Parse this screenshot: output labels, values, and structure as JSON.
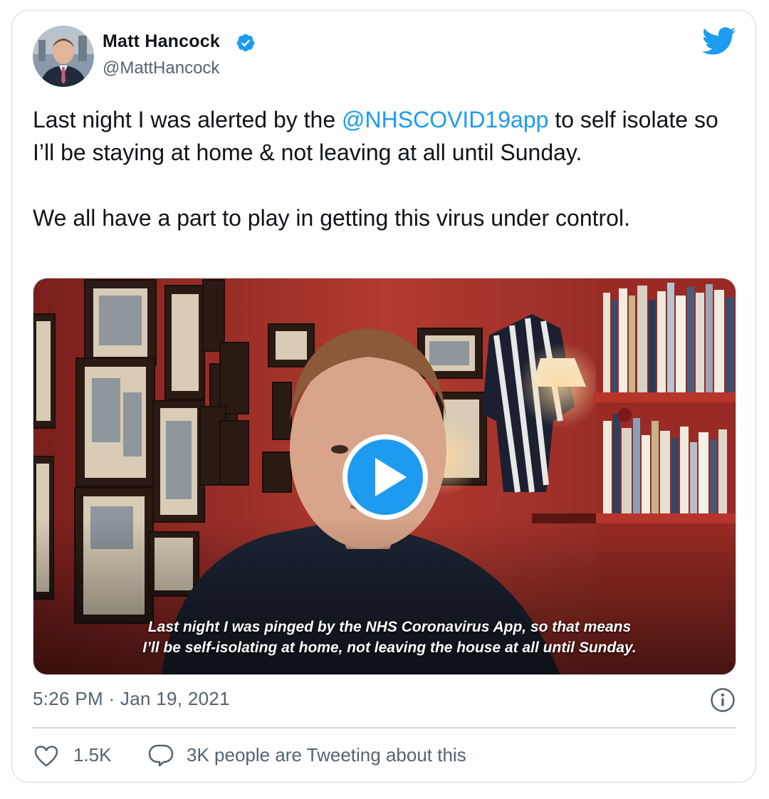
{
  "author": {
    "name": "Matt Hancock",
    "handle": "@MattHancock",
    "verified": true,
    "verified_icon": "verified-badge-icon",
    "avatar_icon": "avatar"
  },
  "brand": {
    "logo_icon": "twitter-bird-icon",
    "color": "#1d9bf0"
  },
  "tweet": {
    "line1_before": "Last night I was alerted by the ",
    "mention": "@NHSCOVID19app",
    "line1_after": " to self isolate so I’ll be staying at home & not leaving at all until Sunday.",
    "paragraph2": "We all have a part to play in getting this virus under control."
  },
  "video": {
    "caption_line1": "Last night I was pinged by the NHS Coronavirus App, so that means",
    "caption_line2": "I’ll be self-isolating at home, not leaving the house at all until Sunday.",
    "play_icon": "play-icon"
  },
  "meta": {
    "timestamp": "5:26 PM · Jan 19, 2021",
    "info_icon": "info-icon"
  },
  "actions": {
    "likes": "1.5K",
    "like_icon": "heart-icon",
    "tweeting_text": "3K people are Tweeting about this",
    "tweeting_icon": "reply-bubble-icon"
  },
  "colors": {
    "text": "#0f1419",
    "secondary": "#536471",
    "link": "#1d9bf0",
    "border": "#cfd9de",
    "wall": "#a8302a"
  }
}
